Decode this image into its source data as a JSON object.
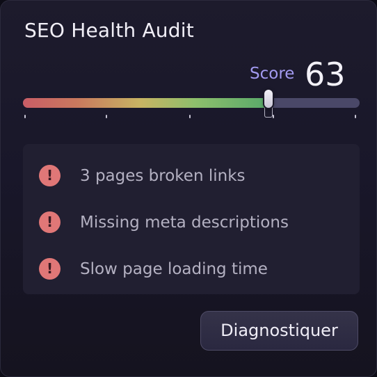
{
  "card": {
    "title": "SEO Health Audit"
  },
  "score": {
    "label": "Score",
    "value": "63",
    "slider_level": 0.73
  },
  "issues": [
    {
      "icon": "alert-circle-icon",
      "text": "3 pages broken links"
    },
    {
      "icon": "alert-circle-icon",
      "text": "Missing meta descriptions"
    },
    {
      "icon": "alert-circle-icon",
      "text": "Slow page loading time"
    }
  ],
  "actions": {
    "diagnose_label": "Diagnostiquer"
  },
  "colors": {
    "accent": "#a29af0",
    "alert": "#e07777",
    "background": "#1a1828"
  }
}
